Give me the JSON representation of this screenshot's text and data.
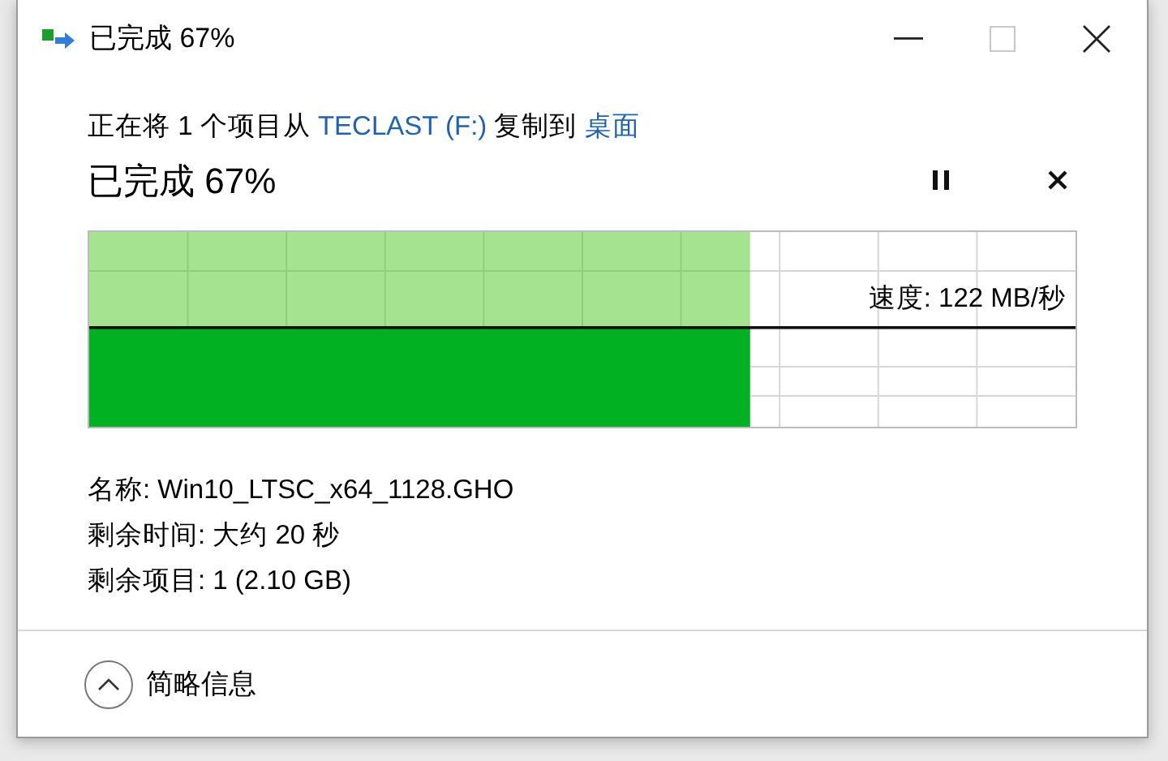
{
  "window": {
    "title": "已完成 67%",
    "maximize_disabled": true
  },
  "copy_line": {
    "prefix": "正在将 1 个项目从 ",
    "source": "TECLAST (F:)",
    "middle": " 复制到 ",
    "destination": "桌面"
  },
  "status": "已完成 67%",
  "progress": {
    "level": 0.67,
    "speed": "速度: 122 MB/秒"
  },
  "details": [
    "名称: Win10_LTSC_x64_1128.GHO",
    "剩余时间: 大约 20 秒",
    "剩余项目: 1 (2.10 GB)"
  ],
  "details_toggle": {
    "label": "简略信息",
    "expanded": true
  }
}
